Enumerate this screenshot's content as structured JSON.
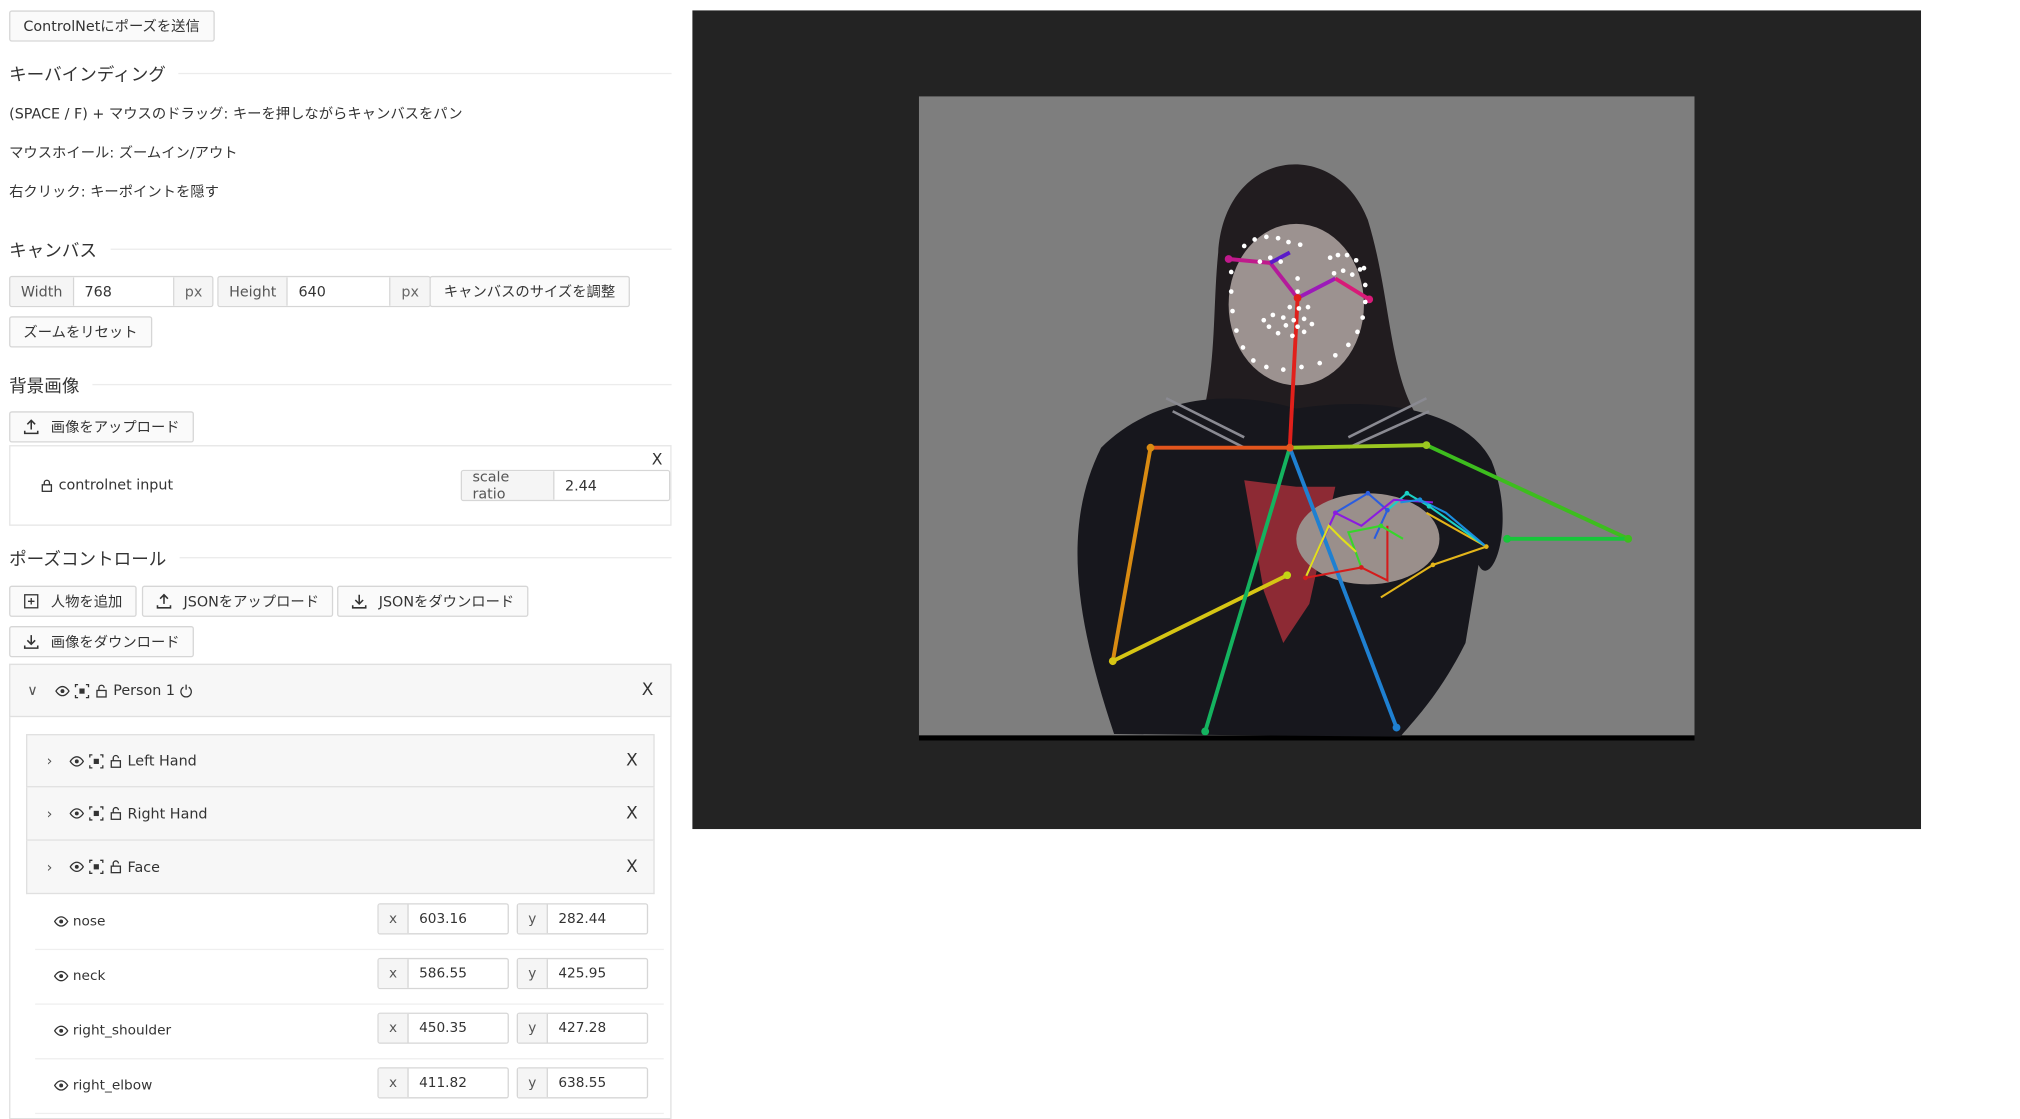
{
  "send_button": "ControlNetにポーズを送信",
  "keybinding": {
    "title": "キーバインディング",
    "lines": [
      "(SPACE / F) + マウスのドラッグ: キーを押しながらキャンバスをパン",
      "マウスホイール: ズームイン/アウト",
      "右クリック: キーポイントを隠す"
    ]
  },
  "canvas": {
    "title": "キャンバス",
    "width_label": "Width",
    "width_value": "768",
    "height_label": "Height",
    "height_value": "640",
    "unit": "px",
    "resize_button": "キャンバスのサイズを調整",
    "reset_zoom_button": "ズームをリセット"
  },
  "background": {
    "title": "背景画像",
    "upload_button": "画像をアップロード",
    "item_name": "controlnet input",
    "scale_label": "scale ratio",
    "scale_value": "2.44",
    "close": "X"
  },
  "pose_control": {
    "title": "ポーズコントロール",
    "add_person": "人物を追加",
    "upload_json": "JSONをアップロード",
    "download_json": "JSONをダウンロード",
    "download_image": "画像をダウンロード"
  },
  "person": {
    "name": "Person 1",
    "close": "X",
    "parts": [
      {
        "name": "Left Hand",
        "close": "X"
      },
      {
        "name": "Right Hand",
        "close": "X"
      },
      {
        "name": "Face",
        "close": "X"
      }
    ],
    "keypoints": [
      {
        "name": "nose",
        "x_label": "x",
        "x": "603.16",
        "y_label": "y",
        "y": "282.44"
      },
      {
        "name": "neck",
        "x_label": "x",
        "x": "586.55",
        "y_label": "y",
        "y": "425.95"
      },
      {
        "name": "right_shoulder",
        "x_label": "x",
        "x": "450.35",
        "y_label": "y",
        "y": "427.28"
      },
      {
        "name": "right_elbow",
        "x_label": "x",
        "x": "411.82",
        "y_label": "y",
        "y": "638.55"
      }
    ]
  },
  "colors": {
    "canvas_bg": "#232323",
    "photo_bg": "#7e7e7e",
    "uniform": "#17171d"
  }
}
